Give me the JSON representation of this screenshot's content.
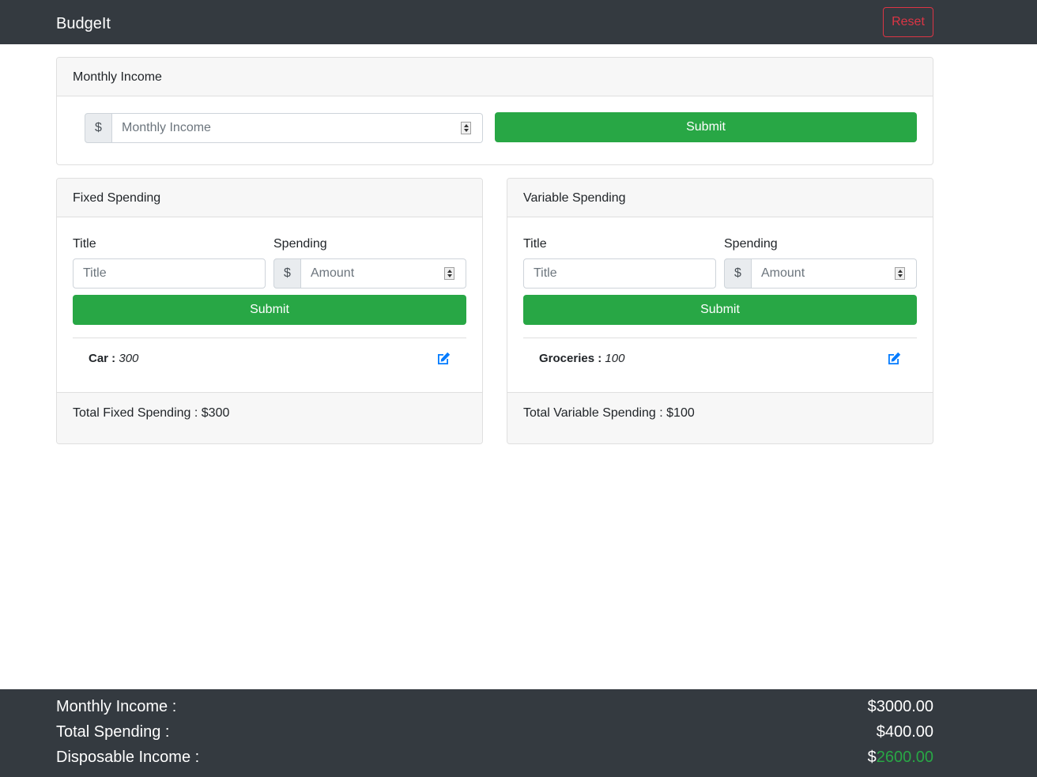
{
  "navbar": {
    "brand": "BudgeIt",
    "reset_label": "Reset"
  },
  "income_card": {
    "header": "Monthly Income",
    "currency": "$",
    "placeholder": "Monthly Income",
    "submit_label": "Submit"
  },
  "fixed_card": {
    "header": "Fixed Spending",
    "title_label": "Title",
    "spending_label": "Spending",
    "title_placeholder": "Title",
    "currency": "$",
    "amount_placeholder": "Amount",
    "submit_label": "Submit",
    "items": [
      {
        "name": "Car :",
        "value": "300"
      }
    ],
    "total": "Total Fixed Spending : $300"
  },
  "variable_card": {
    "header": "Variable Spending",
    "title_label": "Title",
    "spending_label": "Spending",
    "title_placeholder": "Title",
    "currency": "$",
    "amount_placeholder": "Amount",
    "submit_label": "Submit",
    "items": [
      {
        "name": "Groceries :",
        "value": "100"
      }
    ],
    "total": "Total Variable Spending : $100"
  },
  "summary": {
    "income_label": "Monthly Income :",
    "income_value": "$3000.00",
    "spending_label": "Total Spending :",
    "spending_value": "$400.00",
    "disposable_label": "Disposable Income :",
    "disposable_currency": "$",
    "disposable_value": "2600.00"
  },
  "colors": {
    "primary_green": "#28a745",
    "danger_red": "#dc3545",
    "dark_bg": "#343a40",
    "edit_blue": "#007bff"
  },
  "icons": {
    "edit": "edit-icon",
    "spinner": "number-spinner-icon"
  }
}
